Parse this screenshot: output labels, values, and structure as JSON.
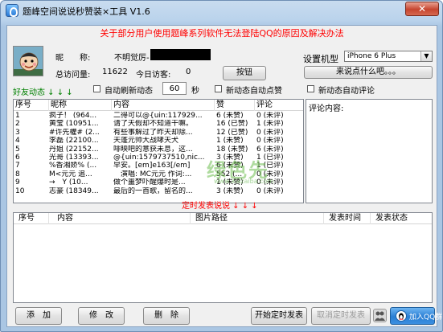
{
  "window": {
    "title": "题峰空间说说秒赞装×工具 V1.6",
    "close_label": "✕"
  },
  "notice": "关于部分用户使用题峰系列软件无法登陆QQ的原因及解决办法",
  "profile": {
    "nickname_label": "昵　　称:",
    "nickname_value": "不明觉厉-",
    "total_visits_label": "总访问量:",
    "total_visits_value": "11622",
    "today_visits_label": "今日访客:",
    "today_visits_value": "0"
  },
  "buttons": {
    "action": "按钮",
    "praise_me": "来说点什么吧。。。",
    "add": "添　加",
    "edit": "修　改",
    "delete": "删　除",
    "start_schedule": "开始定时发表",
    "cancel_schedule": "取消定时发表",
    "join_qq": "加入QQ群"
  },
  "device": {
    "label": "设置机型",
    "selected": "iPhone 6 Plus"
  },
  "options": {
    "friend_feed": "好友动态 ↓ ↓ ↓",
    "auto_refresh": "自动刷新动态",
    "interval_value": "60",
    "interval_unit": "秒",
    "auto_like": "新动态自动点赞",
    "auto_comment": "新动态自动评论",
    "comment_content_label": "评论内容:"
  },
  "feed_table": {
    "headers": [
      "序号",
      "昵称",
      "内容",
      "赞",
      "评论"
    ],
    "rows": [
      [
        "1",
        "疯子！ (964...",
        "二得可以@{uin:117929...",
        "6 (未赞)",
        "0 (未评)"
      ],
      [
        "2",
        "黄莹 (10951...",
        "请了天假却不知道干嘛。",
        "16 (已赞)",
        "1 (未评)"
      ],
      [
        "3",
        "#许先權# (2...",
        "有些事解过了昨天却除...",
        "12 (已赞)",
        "0 (未评)"
      ],
      [
        "4",
        "李磊 (22100...",
        "天蓬元帅大战哮天犬",
        "1 (未赞)",
        "0 (未评)"
      ],
      [
        "5",
        "丹姐 (22152...",
        "啡映吧的意获未息，这...",
        "18 (未赞)",
        "6 (未评)"
      ],
      [
        "6",
        "光哥 (13393...",
        "@{uin:1579737510,nic...",
        "3 (未赞)",
        "1 (已评)"
      ],
      [
        "7",
        "%香湘娇% (...",
        "早安。[em]e163[/em]",
        "6 (未赞)",
        "1 (已评)"
      ],
      [
        "8",
        "M<元元 追...",
        "　演唱: MC元元 作词:...",
        "552 (...",
        "0 (未评)"
      ],
      [
        "9",
        "→　Y (10...",
        "做个噩梦吓醒爆时是...",
        "1 (未赞)",
        "0 (未评)"
      ],
      [
        "10",
        "志豪 (18349...",
        "最后的一首歌，留名的...",
        "3 (未赞)",
        "0 (未评)"
      ]
    ]
  },
  "schedule": {
    "title": "定时发表说说 ↓ ↓ ↓",
    "headers": [
      "序号",
      "内容",
      "图片路径",
      "发表时间",
      "发表状态"
    ]
  },
  "watermark": {
    "main": "绿色先",
    "sub": "www.xiazaiba.com"
  },
  "colors": {
    "notice": "#ff0000",
    "feed_label": "#008000",
    "title_bar": "#bad3ec"
  }
}
